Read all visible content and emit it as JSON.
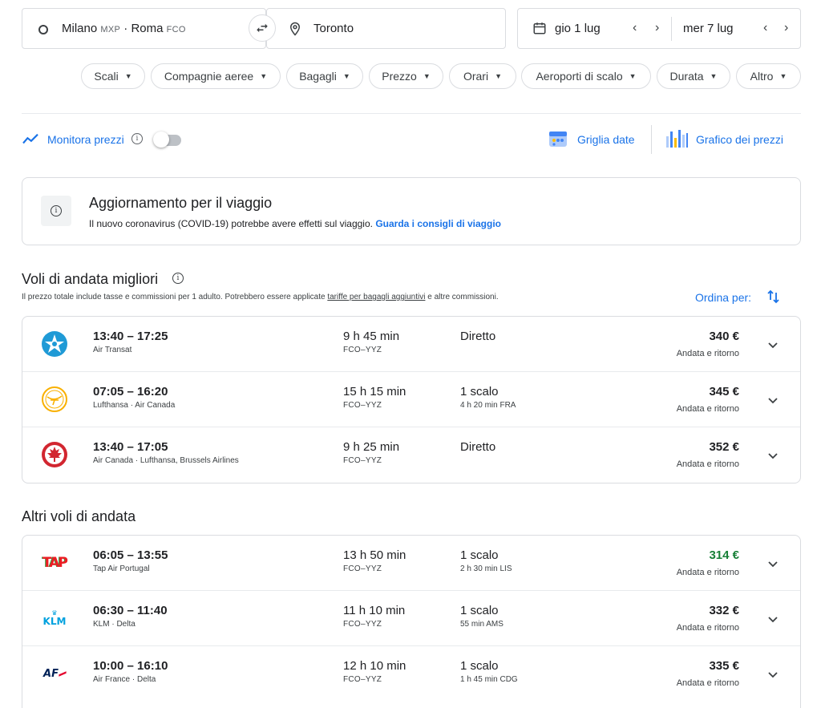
{
  "search": {
    "origin": "Milano",
    "origin_code1": "MXP",
    "origin_sep": " · ",
    "origin_city2": "Roma",
    "origin_code2": "FCO",
    "destination": "Toronto",
    "depart_date": "gio 1 lug",
    "return_date": "mer 7 lug"
  },
  "filters": [
    {
      "label": "Scali"
    },
    {
      "label": "Compagnie aeree"
    },
    {
      "label": "Bagagli"
    },
    {
      "label": "Prezzo"
    },
    {
      "label": "Orari"
    },
    {
      "label": "Aeroporti di scalo"
    },
    {
      "label": "Durata"
    },
    {
      "label": "Altro"
    }
  ],
  "tools": {
    "track_prices": "Monitora prezzi",
    "date_grid": "Griglia date",
    "price_graph": "Grafico dei prezzi"
  },
  "travel_update": {
    "title": "Aggiornamento per il viaggio",
    "text": "Il nuovo coronavirus (COVID-19) potrebbe avere effetti sul viaggio.",
    "link": "Guarda i consigli di viaggio"
  },
  "best": {
    "title": "Voli di andata migliori",
    "note_pre": "Il prezzo totale include tasse e commissioni per 1 adulto. Potrebbero essere applicate",
    "note_link": "tariffe per bagagli aggiuntivi",
    "note_post": "e altre commissioni.",
    "sort_label": "Ordina per:",
    "flights": [
      {
        "logo": "air-transat",
        "times": "13:40 – 17:25",
        "airline": "Air Transat",
        "duration": "9 h 45 min",
        "route": "FCO–YYZ",
        "stops": "Diretto",
        "stop_info": "",
        "price": "340 €",
        "price_type": "Andata e ritorno"
      },
      {
        "logo": "lufthansa",
        "times": "07:05 – 16:20",
        "airline": "Lufthansa · Air Canada",
        "duration": "15 h 15 min",
        "route": "FCO–YYZ",
        "stops": "1 scalo",
        "stop_info": "4 h 20 min FRA",
        "price": "345 €",
        "price_type": "Andata e ritorno"
      },
      {
        "logo": "air-canada",
        "times": "13:40 – 17:05",
        "airline": "Air Canada · Lufthansa, Brussels Airlines",
        "duration": "9 h 25 min",
        "route": "FCO–YYZ",
        "stops": "Diretto",
        "stop_info": "",
        "price": "352 €",
        "price_type": "Andata e ritorno"
      }
    ]
  },
  "other": {
    "title": "Altri voli di andata",
    "flights": [
      {
        "logo": "tap",
        "logo_text": "TAP",
        "times": "06:05 – 13:55",
        "airline": "Tap Air Portugal",
        "duration": "13 h 50 min",
        "route": "FCO–YYZ",
        "stops": "1 scalo",
        "stop_info": "2 h 30 min LIS",
        "price": "314 €",
        "price_type": "Andata e ritorno",
        "price_color": "#188038"
      },
      {
        "logo": "klm",
        "logo_text": "KLM",
        "times": "06:30 – 11:40",
        "airline": "KLM · Delta",
        "duration": "11 h 10 min",
        "route": "FCO–YYZ",
        "stops": "1 scalo",
        "stop_info": "55 min AMS",
        "price": "332 €",
        "price_type": "Andata e ritorno"
      },
      {
        "logo": "air-france",
        "logo_text": "AF",
        "times": "10:00 – 16:10",
        "airline": "Air France · Delta",
        "duration": "12 h 10 min",
        "route": "FCO–YYZ",
        "stops": "1 scalo",
        "stop_info": "1 h 45 min CDG",
        "price": "335 €",
        "price_type": "Andata e ritorno"
      }
    ]
  },
  "colors": {
    "accent": "#1a73e8",
    "cheap": "#188038",
    "border": "#dadce0"
  }
}
